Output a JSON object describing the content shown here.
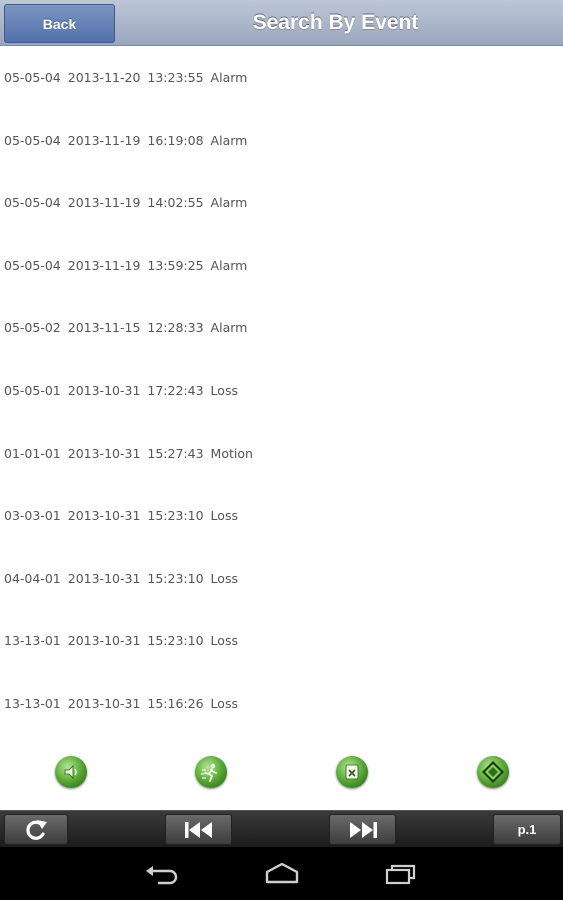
{
  "header": {
    "back_label": "Back",
    "title": "Search By Event"
  },
  "events": [
    {
      "channel": "05-05-04",
      "date": "2013-11-20",
      "time": "13:23:55",
      "type": "Alarm"
    },
    {
      "channel": "05-05-04",
      "date": "2013-11-19",
      "time": "16:19:08",
      "type": "Alarm"
    },
    {
      "channel": "05-05-04",
      "date": "2013-11-19",
      "time": "14:02:55",
      "type": "Alarm"
    },
    {
      "channel": "05-05-04",
      "date": "2013-11-19",
      "time": "13:59:25",
      "type": "Alarm"
    },
    {
      "channel": "05-05-02",
      "date": "2013-11-15",
      "time": "12:28:33",
      "type": "Alarm"
    },
    {
      "channel": "05-05-01",
      "date": "2013-10-31",
      "time": "17:22:43",
      "type": "Loss"
    },
    {
      "channel": "01-01-01",
      "date": "2013-10-31",
      "time": "15:27:43",
      "type": "Motion"
    },
    {
      "channel": "03-03-01",
      "date": "2013-10-31",
      "time": "15:23:10",
      "type": "Loss"
    },
    {
      "channel": "04-04-01",
      "date": "2013-10-31",
      "time": "15:23:10",
      "type": "Loss"
    },
    {
      "channel": "13-13-01",
      "date": "2013-10-31",
      "time": "15:23:10",
      "type": "Loss"
    },
    {
      "channel": "13-13-01",
      "date": "2013-10-31",
      "time": "15:16:26",
      "type": "Loss"
    }
  ],
  "actions": [
    {
      "icon": "speaker-icon"
    },
    {
      "icon": "motion-icon"
    },
    {
      "icon": "video-loss-icon"
    },
    {
      "icon": "alarm-sensor-icon"
    }
  ],
  "toolbar": {
    "refresh_icon": "refresh-icon",
    "prev_icon": "skip-previous-icon",
    "next_icon": "skip-next-icon",
    "page_label": "p.1"
  },
  "navbar": {
    "back_icon": "nav-back-icon",
    "home_icon": "nav-home-icon",
    "recents_icon": "nav-recents-icon"
  },
  "colors": {
    "header_bg": "#9aa6bd",
    "back_button": "#5371aa",
    "toolbar_bg": "#1c1c1c",
    "icon_green": "#5fae3a"
  }
}
